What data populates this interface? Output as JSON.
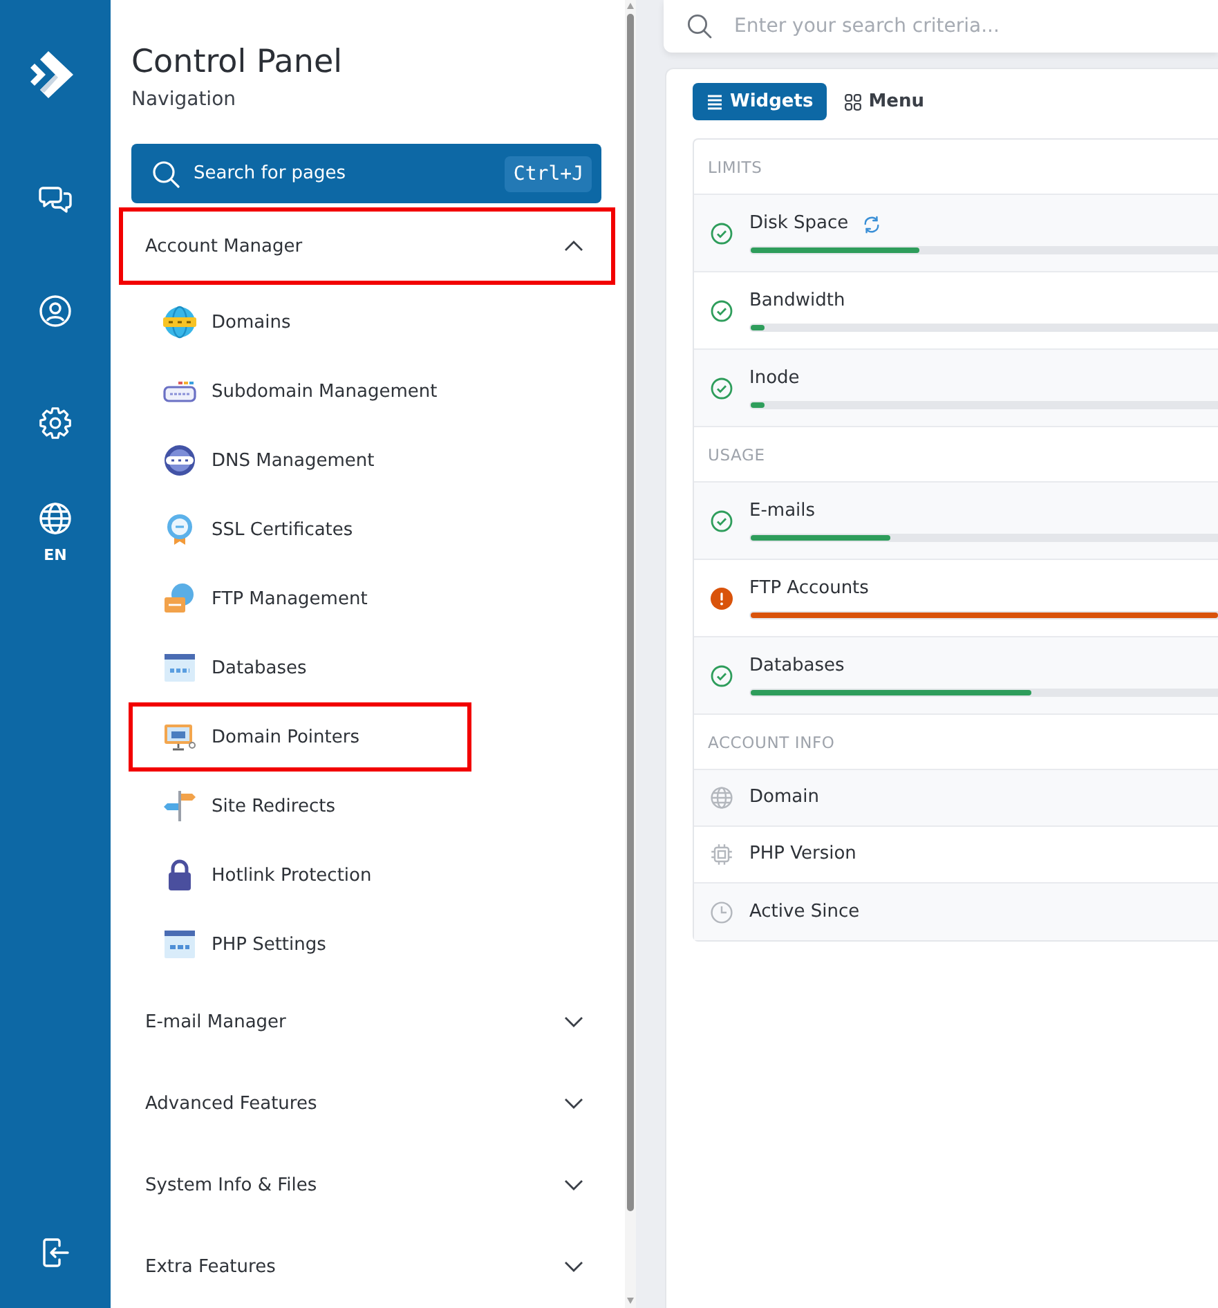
{
  "rail": {
    "language": "EN"
  },
  "sidebar": {
    "title": "Control Panel",
    "subtitle": "Navigation",
    "search": {
      "label": "Search for pages",
      "shortcut": "Ctrl+J"
    },
    "groups": [
      {
        "label": "Account Manager",
        "expanded": true,
        "highlighted": true,
        "children": [
          {
            "label": "Domains",
            "highlighted": false
          },
          {
            "label": "Subdomain Management",
            "highlighted": false
          },
          {
            "label": "DNS Management",
            "highlighted": false
          },
          {
            "label": "SSL Certificates",
            "highlighted": false
          },
          {
            "label": "FTP Management",
            "highlighted": false
          },
          {
            "label": "Databases",
            "highlighted": false
          },
          {
            "label": "Domain Pointers",
            "highlighted": true
          },
          {
            "label": "Site Redirects",
            "highlighted": false
          },
          {
            "label": "Hotlink Protection",
            "highlighted": false
          },
          {
            "label": "PHP Settings",
            "highlighted": false
          }
        ]
      },
      {
        "label": "E-mail Manager",
        "expanded": false,
        "highlighted": false
      },
      {
        "label": "Advanced Features",
        "expanded": false,
        "highlighted": false
      },
      {
        "label": "System Info & Files",
        "expanded": false,
        "highlighted": false
      },
      {
        "label": "Extra Features",
        "expanded": false,
        "highlighted": false
      }
    ]
  },
  "search": {
    "placeholder": "Enter your search criteria..."
  },
  "view_tabs": [
    {
      "label": "Widgets",
      "selected": true
    },
    {
      "label": "Menu",
      "selected": false
    }
  ],
  "widgets": {
    "sections": [
      {
        "title": "LIMITS",
        "kind": "meters",
        "rows": [
          {
            "label": "Disk Space",
            "kind": "ok",
            "level": 0.36,
            "refresh": true
          },
          {
            "label": "Bandwidth",
            "kind": "ok",
            "level": 0.03,
            "refresh": false
          },
          {
            "label": "Inode",
            "kind": "ok",
            "level": 0.03,
            "refresh": false
          }
        ]
      },
      {
        "title": "USAGE",
        "kind": "meters",
        "rows": [
          {
            "label": "E-mails",
            "kind": "ok",
            "level": 0.3,
            "refresh": false
          },
          {
            "label": "FTP Accounts",
            "kind": "warning",
            "level": 1,
            "refresh": false
          },
          {
            "label": "Databases",
            "kind": "ok",
            "level": 0.6,
            "refresh": false
          }
        ]
      },
      {
        "title": "ACCOUNT INFO",
        "kind": "info",
        "rows": [
          {
            "label": "Domain"
          },
          {
            "label": "PHP Version"
          },
          {
            "label": "Active Since"
          }
        ]
      }
    ]
  }
}
